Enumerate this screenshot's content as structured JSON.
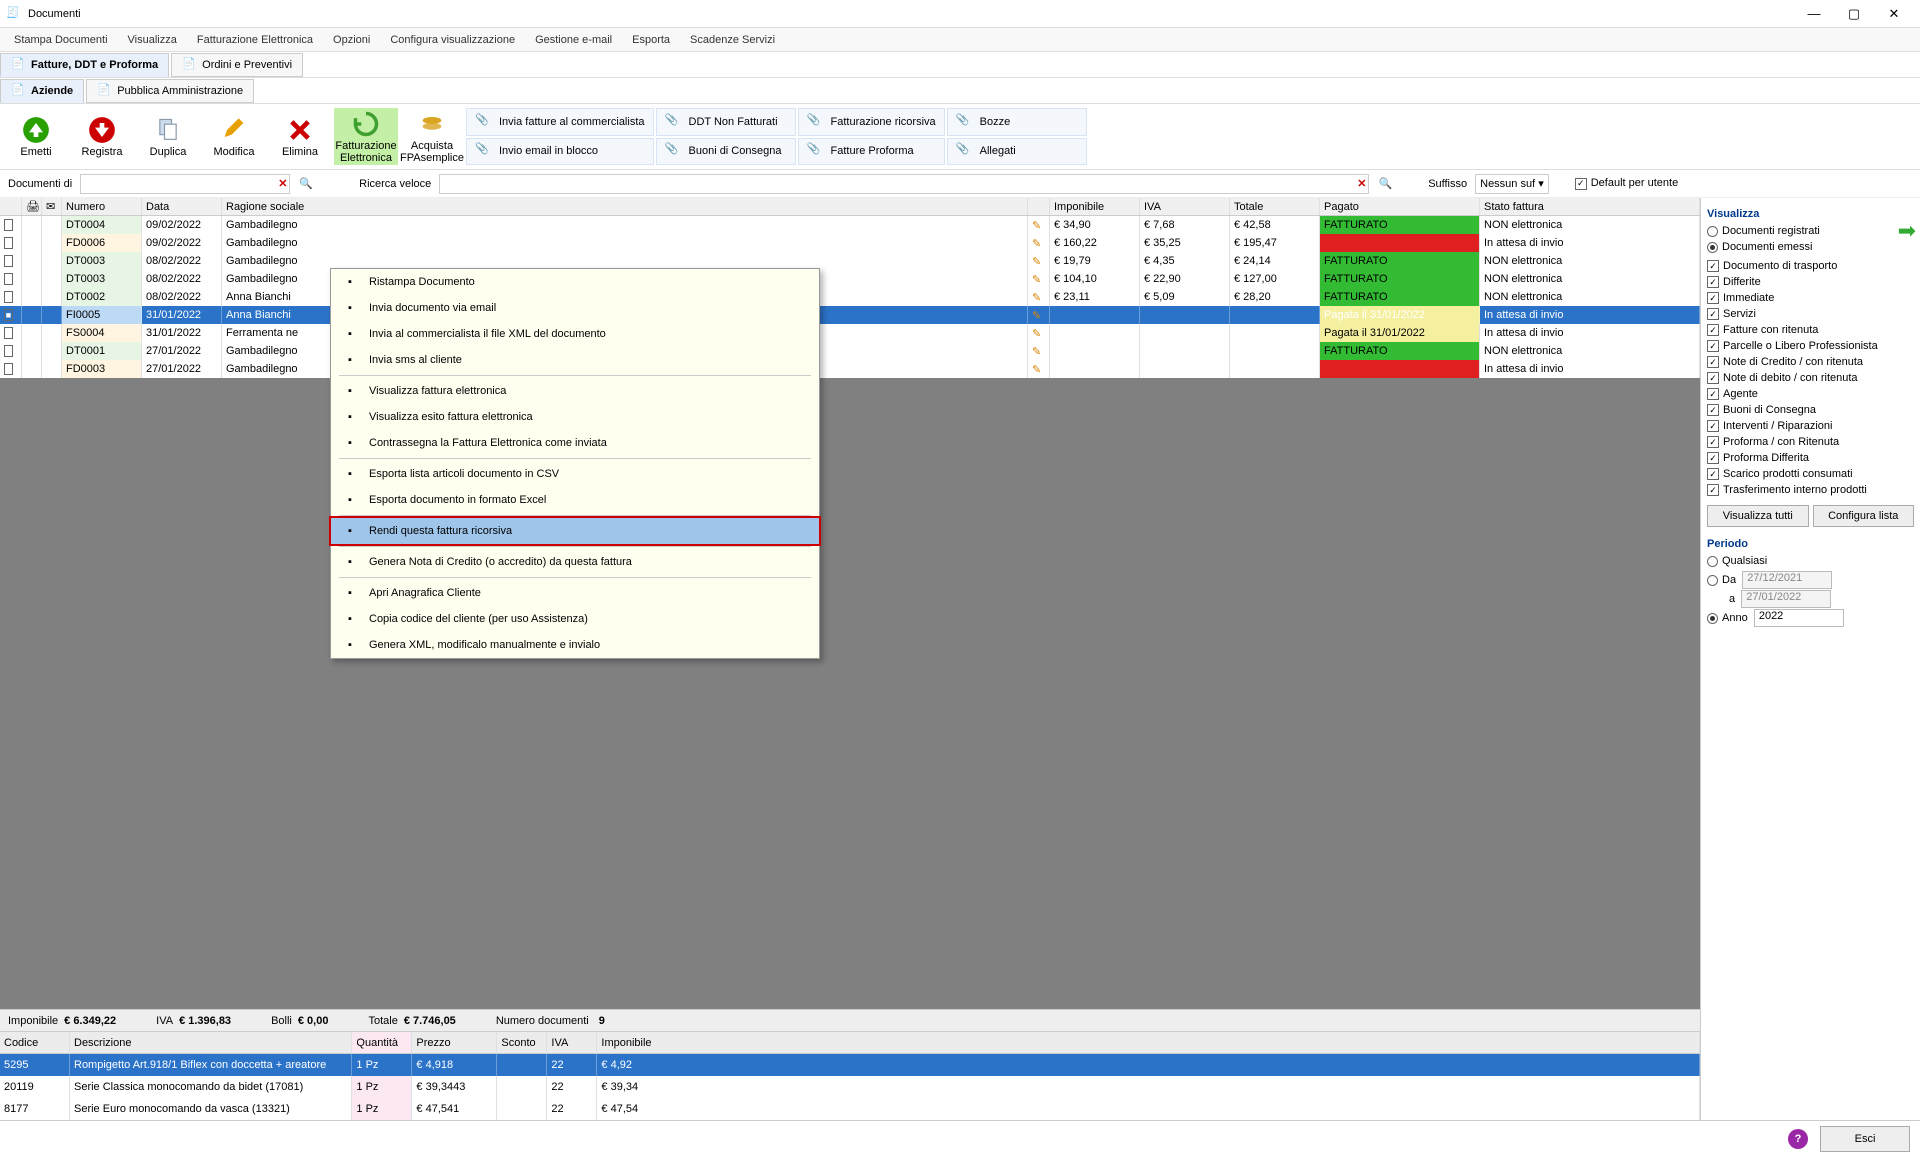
{
  "window": {
    "title": "Documenti"
  },
  "menubar": [
    "Stampa Documenti",
    "Visualizza",
    "Fatturazione Elettronica",
    "Opzioni",
    "Configura visualizzazione",
    "Gestione e-mail",
    "Esporta",
    "Scadenze Servizi"
  ],
  "tabs1": [
    {
      "id": "fatture",
      "label": "Fatture, DDT e Proforma",
      "active": true
    },
    {
      "id": "ordini",
      "label": "Ordini e Preventivi",
      "active": false
    }
  ],
  "tabs2": [
    {
      "id": "aziende",
      "label": "Aziende",
      "active": true
    },
    {
      "id": "pa",
      "label": "Pubblica Amministrazione",
      "active": false
    }
  ],
  "toolbar_big": [
    {
      "id": "emetti",
      "label": "Emetti",
      "color": "#28a000",
      "shape": "up"
    },
    {
      "id": "registra",
      "label": "Registra",
      "color": "#cc0000",
      "shape": "down"
    },
    {
      "id": "duplica",
      "label": "Duplica",
      "color": "#7da6d9",
      "shape": "copy"
    },
    {
      "id": "modifica",
      "label": "Modifica",
      "color": "#e8a000",
      "shape": "pencil"
    },
    {
      "id": "elimina",
      "label": "Elimina",
      "color": "#cc0000",
      "shape": "x"
    },
    {
      "id": "fattel",
      "label": "Fatturazione Elettronica",
      "color": "#40a030",
      "shape": "recycle",
      "highlight": true
    },
    {
      "id": "fpa",
      "label": "Acquista FPAsemplice",
      "color": "#daa520",
      "shape": "coins"
    }
  ],
  "toolbar_small": [
    [
      {
        "id": "invfatcomm",
        "label": "Invia fatture al commercialista"
      },
      {
        "id": "invemail",
        "label": "Invio email in blocco"
      }
    ],
    [
      {
        "id": "ddtnon",
        "label": "DDT Non Fatturati"
      },
      {
        "id": "buonicons",
        "label": "Buoni di Consegna"
      }
    ],
    [
      {
        "id": "fattric",
        "label": "Fatturazione ricorsiva"
      },
      {
        "id": "fattprof",
        "label": "Fatture Proforma"
      }
    ],
    [
      {
        "id": "bozze",
        "label": "Bozze"
      },
      {
        "id": "allegati",
        "label": "Allegati"
      }
    ]
  ],
  "searchrow": {
    "documenti_di": "Documenti di",
    "ricerca_veloce": "Ricerca veloce",
    "suffisso": "Suffisso",
    "suffisso_val": "Nessun suf",
    "default_utente": "Default per utente"
  },
  "columns": [
    "",
    "",
    "",
    "Numero",
    "Data",
    "Ragione sociale",
    "",
    "Imponibile",
    "IVA",
    "Totale",
    "Pagato",
    "Stato fattura"
  ],
  "rows": [
    {
      "t": "dt",
      "num": "DT0004",
      "date": "09/02/2022",
      "rag": "Gambadilegno",
      "imp": "€ 34,90",
      "iva": "€ 7,68",
      "tot": "€ 42,58",
      "pag": "FATTURATO",
      "pagc": "green",
      "stat": "NON elettronica"
    },
    {
      "t": "fd",
      "num": "FD0006",
      "date": "09/02/2022",
      "rag": "Gambadilegno",
      "imp": "€ 160,22",
      "iva": "€ 35,25",
      "tot": "€ 195,47",
      "pag": "",
      "pagc": "red",
      "stat": "In attesa di invio"
    },
    {
      "t": "dt",
      "num": "DT0003",
      "date": "08/02/2022",
      "rag": "Gambadilegno",
      "imp": "€ 19,79",
      "iva": "€ 4,35",
      "tot": "€ 24,14",
      "pag": "FATTURATO",
      "pagc": "green",
      "stat": "NON elettronica"
    },
    {
      "t": "dt",
      "num": "DT0003",
      "date": "08/02/2022",
      "rag": "Gambadilegno",
      "imp": "€ 104,10",
      "iva": "€ 22,90",
      "tot": "€ 127,00",
      "pag": "FATTURATO",
      "pagc": "green",
      "stat": "NON elettronica"
    },
    {
      "t": "dt",
      "num": "DT0002",
      "date": "08/02/2022",
      "rag": "Anna Bianchi",
      "imp": "€ 23,11",
      "iva": "€ 5,09",
      "tot": "€ 28,20",
      "pag": "FATTURATO",
      "pagc": "green",
      "stat": "NON elettronica"
    },
    {
      "t": "fi",
      "num": "FI0005",
      "date": "31/01/2022",
      "rag": "Anna Bianchi",
      "imp": "",
      "iva": "",
      "tot": "",
      "pag": "Pagata il 31/01/2022",
      "pagc": "yellow",
      "stat": "In attesa di invio",
      "sel": true
    },
    {
      "t": "fs",
      "num": "FS0004",
      "date": "31/01/2022",
      "rag": "Ferramenta ne",
      "imp": "",
      "iva": "",
      "tot": "",
      "pag": "Pagata il 31/01/2022",
      "pagc": "yellow",
      "stat": "In attesa di invio"
    },
    {
      "t": "dt",
      "num": "DT0001",
      "date": "27/01/2022",
      "rag": "Gambadilegno",
      "imp": "",
      "iva": "",
      "tot": "",
      "pag": "FATTURATO",
      "pagc": "green",
      "stat": "NON elettronica"
    },
    {
      "t": "fd",
      "num": "FD0003",
      "date": "27/01/2022",
      "rag": "Gambadilegno",
      "imp": "",
      "iva": "",
      "tot": "",
      "pag": "",
      "pagc": "red",
      "stat": "In attesa di invio"
    }
  ],
  "context_menu": [
    {
      "label": "Ristampa Documento"
    },
    {
      "label": "Invia documento via email"
    },
    {
      "label": "Invia al commercialista il file XML del documento"
    },
    {
      "label": "Invia sms al cliente"
    },
    {
      "sep": true
    },
    {
      "label": "Visualizza fattura elettronica"
    },
    {
      "label": "Visualizza esito fattura elettronica"
    },
    {
      "label": "Contrassegna la Fattura Elettronica come inviata"
    },
    {
      "sep": true
    },
    {
      "label": "Esporta lista articoli documento in CSV"
    },
    {
      "label": "Esporta documento in formato Excel"
    },
    {
      "sep": true
    },
    {
      "label": "Rendi questa fattura ricorsiva",
      "hov": true,
      "boxed": true
    },
    {
      "sep": true
    },
    {
      "label": "Genera Nota di Credito (o accredito) da questa fattura"
    },
    {
      "sep": true
    },
    {
      "label": "Apri Anagrafica Cliente"
    },
    {
      "label": "Copia codice del cliente (per uso Assistenza)"
    },
    {
      "label": "Genera XML, modificalo manualmente e invialo"
    }
  ],
  "summary": {
    "imponibile_l": "Imponibile",
    "imponibile_v": "€ 6.349,22",
    "iva_l": "IVA",
    "iva_v": "€ 1.396,83",
    "bolli_l": "Bolli",
    "bolli_v": "€ 0,00",
    "totale_l": "Totale",
    "totale_v": "€ 7.746,05",
    "ndoc_l": "Numero documenti",
    "ndoc_v": "9"
  },
  "detail_columns": [
    "Codice",
    "Descrizione",
    "Quantità",
    "Prezzo",
    "Sconto",
    "IVA",
    "Imponibile"
  ],
  "detail_rows": [
    {
      "cod": "5295",
      "desc": "Rompigetto Art.918/1 Biflex con doccetta + areatore",
      "qta": "1 Pz",
      "prz": "€ 4,918",
      "sc": "",
      "iva": "22",
      "imp": "€ 4,92",
      "sel": true
    },
    {
      "cod": "20119",
      "desc": "Serie Classica monocomando da bidet (17081)",
      "qta": "1 Pz",
      "prz": "€ 39,3443",
      "sc": "",
      "iva": "22",
      "imp": "€ 39,34"
    },
    {
      "cod": "8177",
      "desc": "Serie Euro monocomando da vasca (13321)",
      "qta": "1 Pz",
      "prz": "€ 47,541",
      "sc": "",
      "iva": "22",
      "imp": "€ 47,54"
    }
  ],
  "side": {
    "visualizza": "Visualizza",
    "radio": [
      {
        "label": "Documenti registrati",
        "on": false
      },
      {
        "label": "Documenti emessi",
        "on": true
      }
    ],
    "checks": [
      "Documento di trasporto",
      "Differite",
      "Immediate",
      "Servizi",
      "Fatture con ritenuta",
      "Parcelle o Libero Professionista",
      "Note di Credito / con ritenuta",
      "Note di debito / con ritenuta",
      "Agente",
      "Buoni di Consegna",
      "Interventi / Riparazioni",
      "Proforma / con Ritenuta",
      "Proforma Differita",
      "Scarico prodotti consumati",
      "Trasferimento interno prodotti"
    ],
    "vis_tutti": "Visualizza tutti",
    "conf_lista": "Configura lista",
    "periodo": "Periodo",
    "period_radio": [
      {
        "label": "Qualsiasi",
        "on": false
      },
      {
        "label": "Da",
        "on": false
      },
      {
        "label": "Anno",
        "on": true
      }
    ],
    "a": "a",
    "date_from": "27/12/2021",
    "date_to": "27/01/2022",
    "anno": "2022"
  },
  "footer": {
    "esci": "Esci"
  }
}
